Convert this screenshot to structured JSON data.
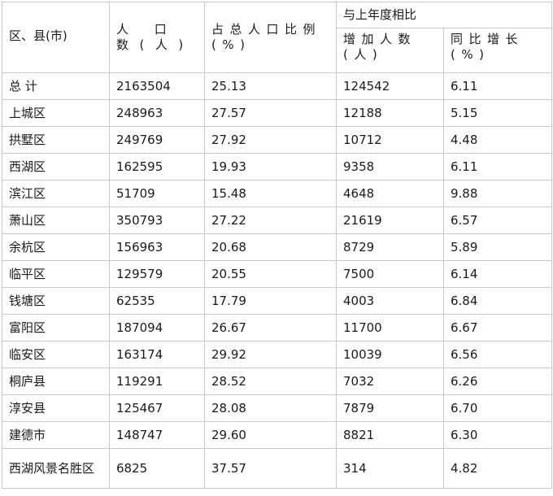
{
  "header": {
    "district": "区、县(市)",
    "population": "人 口 数(人)",
    "share": "占总人口比例(%)",
    "comparison": "与上年度相比",
    "increase": "增加人数(人)",
    "growth": "同比增长(%)"
  },
  "rows": [
    {
      "name": "总 计",
      "pop": "2163504",
      "share": "25.13",
      "inc": "124542",
      "growth": "6.11"
    },
    {
      "name": "上城区",
      "pop": "248963",
      "share": "27.57",
      "inc": "12188",
      "growth": "5.15"
    },
    {
      "name": "拱墅区",
      "pop": "249769",
      "share": "27.92",
      "inc": "10712",
      "growth": "4.48"
    },
    {
      "name": "西湖区",
      "pop": "162595",
      "share": "19.93",
      "inc": "9358",
      "growth": "6.11"
    },
    {
      "name": "滨江区",
      "pop": "51709",
      "share": "15.48",
      "inc": "4648",
      "growth": "9.88"
    },
    {
      "name": "萧山区",
      "pop": "350793",
      "share": "27.22",
      "inc": "21619",
      "growth": "6.57"
    },
    {
      "name": "余杭区",
      "pop": "156963",
      "share": "20.68",
      "inc": "8729",
      "growth": "5.89"
    },
    {
      "name": "临平区",
      "pop": "129579",
      "share": "20.55",
      "inc": "7500",
      "growth": "6.14"
    },
    {
      "name": "钱塘区",
      "pop": "62535",
      "share": "17.79",
      "inc": "4003",
      "growth": "6.84"
    },
    {
      "name": "富阳区",
      "pop": "187094",
      "share": "26.67",
      "inc": "11700",
      "growth": "6.67"
    },
    {
      "name": "临安区",
      "pop": "163174",
      "share": "29.92",
      "inc": "10039",
      "growth": "6.56"
    },
    {
      "name": "桐庐县",
      "pop": "119291",
      "share": "28.52",
      "inc": "7032",
      "growth": "6.26"
    },
    {
      "name": "淳安县",
      "pop": "125467",
      "share": "28.08",
      "inc": "7879",
      "growth": "6.70"
    },
    {
      "name": "建德市",
      "pop": "148747",
      "share": "29.60",
      "inc": "8821",
      "growth": "6.30"
    },
    {
      "name": "西湖风景名胜区",
      "pop": "6825",
      "share": "37.57",
      "inc": "314",
      "growth": "4.82"
    }
  ]
}
